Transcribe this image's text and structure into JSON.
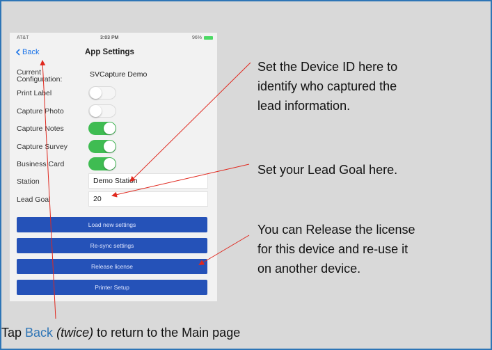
{
  "status_bar": {
    "carrier": "AT&T",
    "time": "3:03 PM",
    "battery": "96%"
  },
  "nav": {
    "back_label": "Back",
    "title": "App Settings"
  },
  "settings": {
    "config_label_1": "Current",
    "config_label_2": "Configuration:",
    "config_value": "SVCapture Demo",
    "print_label": "Print Label",
    "print_label_on": false,
    "capture_photo": "Capture Photo",
    "capture_photo_on": false,
    "capture_notes": "Capture Notes",
    "capture_notes_on": true,
    "capture_survey": "Capture Survey",
    "capture_survey_on": true,
    "business_card": "Business Card",
    "business_card_on": true,
    "station_label": "Station",
    "station_value": "Demo Station",
    "lead_goal_label": "Lead Goal",
    "lead_goal_value": "20"
  },
  "buttons": {
    "load": "Load new settings",
    "resync": "Re-sync settings",
    "release": "Release license",
    "printer": "Printer Setup"
  },
  "callouts": {
    "device_id_1": "Set the Device ID here to",
    "device_id_2": "identify who captured the",
    "device_id_3": "lead information.",
    "lead_goal": "Set your Lead Goal here.",
    "release_1": "You can Release the license",
    "release_2": "for this device and re-use it",
    "release_3": "on another device."
  },
  "footer": {
    "prefix": "Tap ",
    "link": "Back",
    "emphasis": "(twice)",
    "suffix": " to return to the Main page"
  },
  "colors": {
    "border": "#2e75b6",
    "background": "#d9d9d9",
    "arrow": "#e0281e",
    "button": "#2552b8",
    "toggle_on": "#3fbc52",
    "link": "#1a73e8"
  }
}
